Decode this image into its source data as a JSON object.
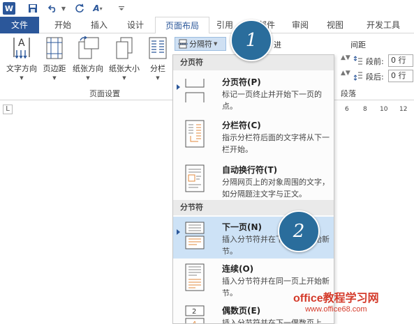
{
  "qat": {
    "word_logo": "W",
    "format_painter": "A"
  },
  "tabs": [
    {
      "label": "文件"
    },
    {
      "label": "开始"
    },
    {
      "label": "插入"
    },
    {
      "label": "设计"
    },
    {
      "label": "页面布局"
    },
    {
      "label": "引用"
    },
    {
      "label": "邮件"
    },
    {
      "label": "审阅"
    },
    {
      "label": "视图"
    },
    {
      "label": "开发工具"
    }
  ],
  "ribbon": {
    "text_direction": "文字方向",
    "margins": "页边距",
    "orientation": "纸张方向",
    "size": "纸张大小",
    "columns": "分栏",
    "breaks_button": "分隔符",
    "page_setup_group": "页面设置",
    "indent_partial": "进",
    "spacing_title": "间距",
    "before_label": "段前:",
    "before_value": "0 行",
    "after_label": "段后:",
    "after_value": "0 行",
    "paragraph_group": "段落"
  },
  "ruler": {
    "corner": "L",
    "ticks": [
      "6",
      "8",
      "10",
      "12"
    ]
  },
  "menu": {
    "section_page_breaks": "分页符",
    "section_section_breaks": "分节符",
    "items": [
      {
        "title": "分页符(P)",
        "desc": "标记一页终止并开始下一页的点。"
      },
      {
        "title": "分栏符(C)",
        "desc": "指示分栏符后面的文字将从下一栏开始。"
      },
      {
        "title": "自动换行符(T)",
        "desc": "分隔网页上的对象周围的文字，如分隔题注文字与正文。"
      },
      {
        "title": "下一页(N)",
        "desc": "插入分节符并在下一页上开始新节。"
      },
      {
        "title": "连续(O)",
        "desc": "插入分节符并在同一页上开始新节。"
      },
      {
        "title": "偶数页(E)",
        "desc": "插入分节符并在下一偶数页上"
      }
    ]
  },
  "badges": {
    "step1": "1",
    "step2": "2"
  },
  "watermark": {
    "brand": "office教程学习网",
    "url": "www.office68.com"
  },
  "colors": {
    "accent": "#2b579a",
    "badge": "#2a6d9c",
    "highlight": "#cde2f6",
    "watermark": "#d43a2a"
  }
}
